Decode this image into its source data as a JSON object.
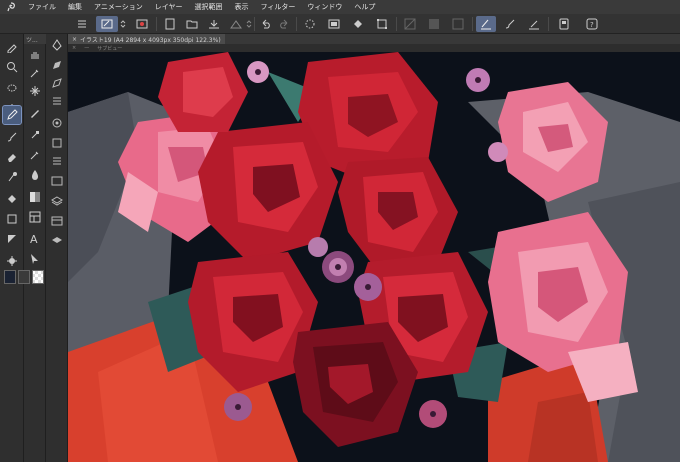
{
  "menu": {
    "items": [
      "ファイル",
      "編集",
      "アニメーション",
      "レイヤー",
      "選択範囲",
      "表示",
      "フィルター",
      "ウィンドウ",
      "ヘルプ"
    ]
  },
  "toolbar": {
    "icons": [
      "hamburger-menu-icon",
      "new-canvas-icon",
      "canvas-settings-icon",
      "new-icon",
      "open-icon",
      "save-icon",
      "upload-icon",
      "undo-icon",
      "redo-icon",
      "deselect-icon",
      "clear-icon",
      "fill-icon",
      "transform-icon",
      "snap-off-icon",
      "snap-ruler-icon",
      "snap-grid-icon",
      "snap-special-icon",
      "stabilizer-icon",
      "ruler-icon",
      "quick-access-icon",
      "help-icon"
    ]
  },
  "document": {
    "tab_title": "イラスト19 (A4 2894 x 4093px 350dpi 122.3%)",
    "subview_label": "サブビュー",
    "close_glyph": "×"
  },
  "tools": {
    "selected": "pen-tool",
    "col1": [
      "color-picker-icon",
      "zoom-icon",
      "hand-icon",
      "lasso-icon",
      "eyedropper-icon",
      "move-icon",
      "sparkle-icon",
      "pen-icon",
      "pencil-icon",
      "brush-icon",
      "airbrush-icon",
      "eraser-icon",
      "blend-icon",
      "fill-icon",
      "gradient-icon",
      "figure-icon",
      "frame-icon",
      "ruler-icon",
      "text-icon",
      "correction-icon",
      "select-arrow-icon"
    ],
    "subtool_header": "ツ...",
    "colors": {
      "main": "#1a2233",
      "sub": "#3a3a3a",
      "transparent": "checker"
    }
  },
  "colors": {
    "accent": "#5a6a8a",
    "panel": "#2f2f2f",
    "canvas_bg": "#0d1420"
  }
}
